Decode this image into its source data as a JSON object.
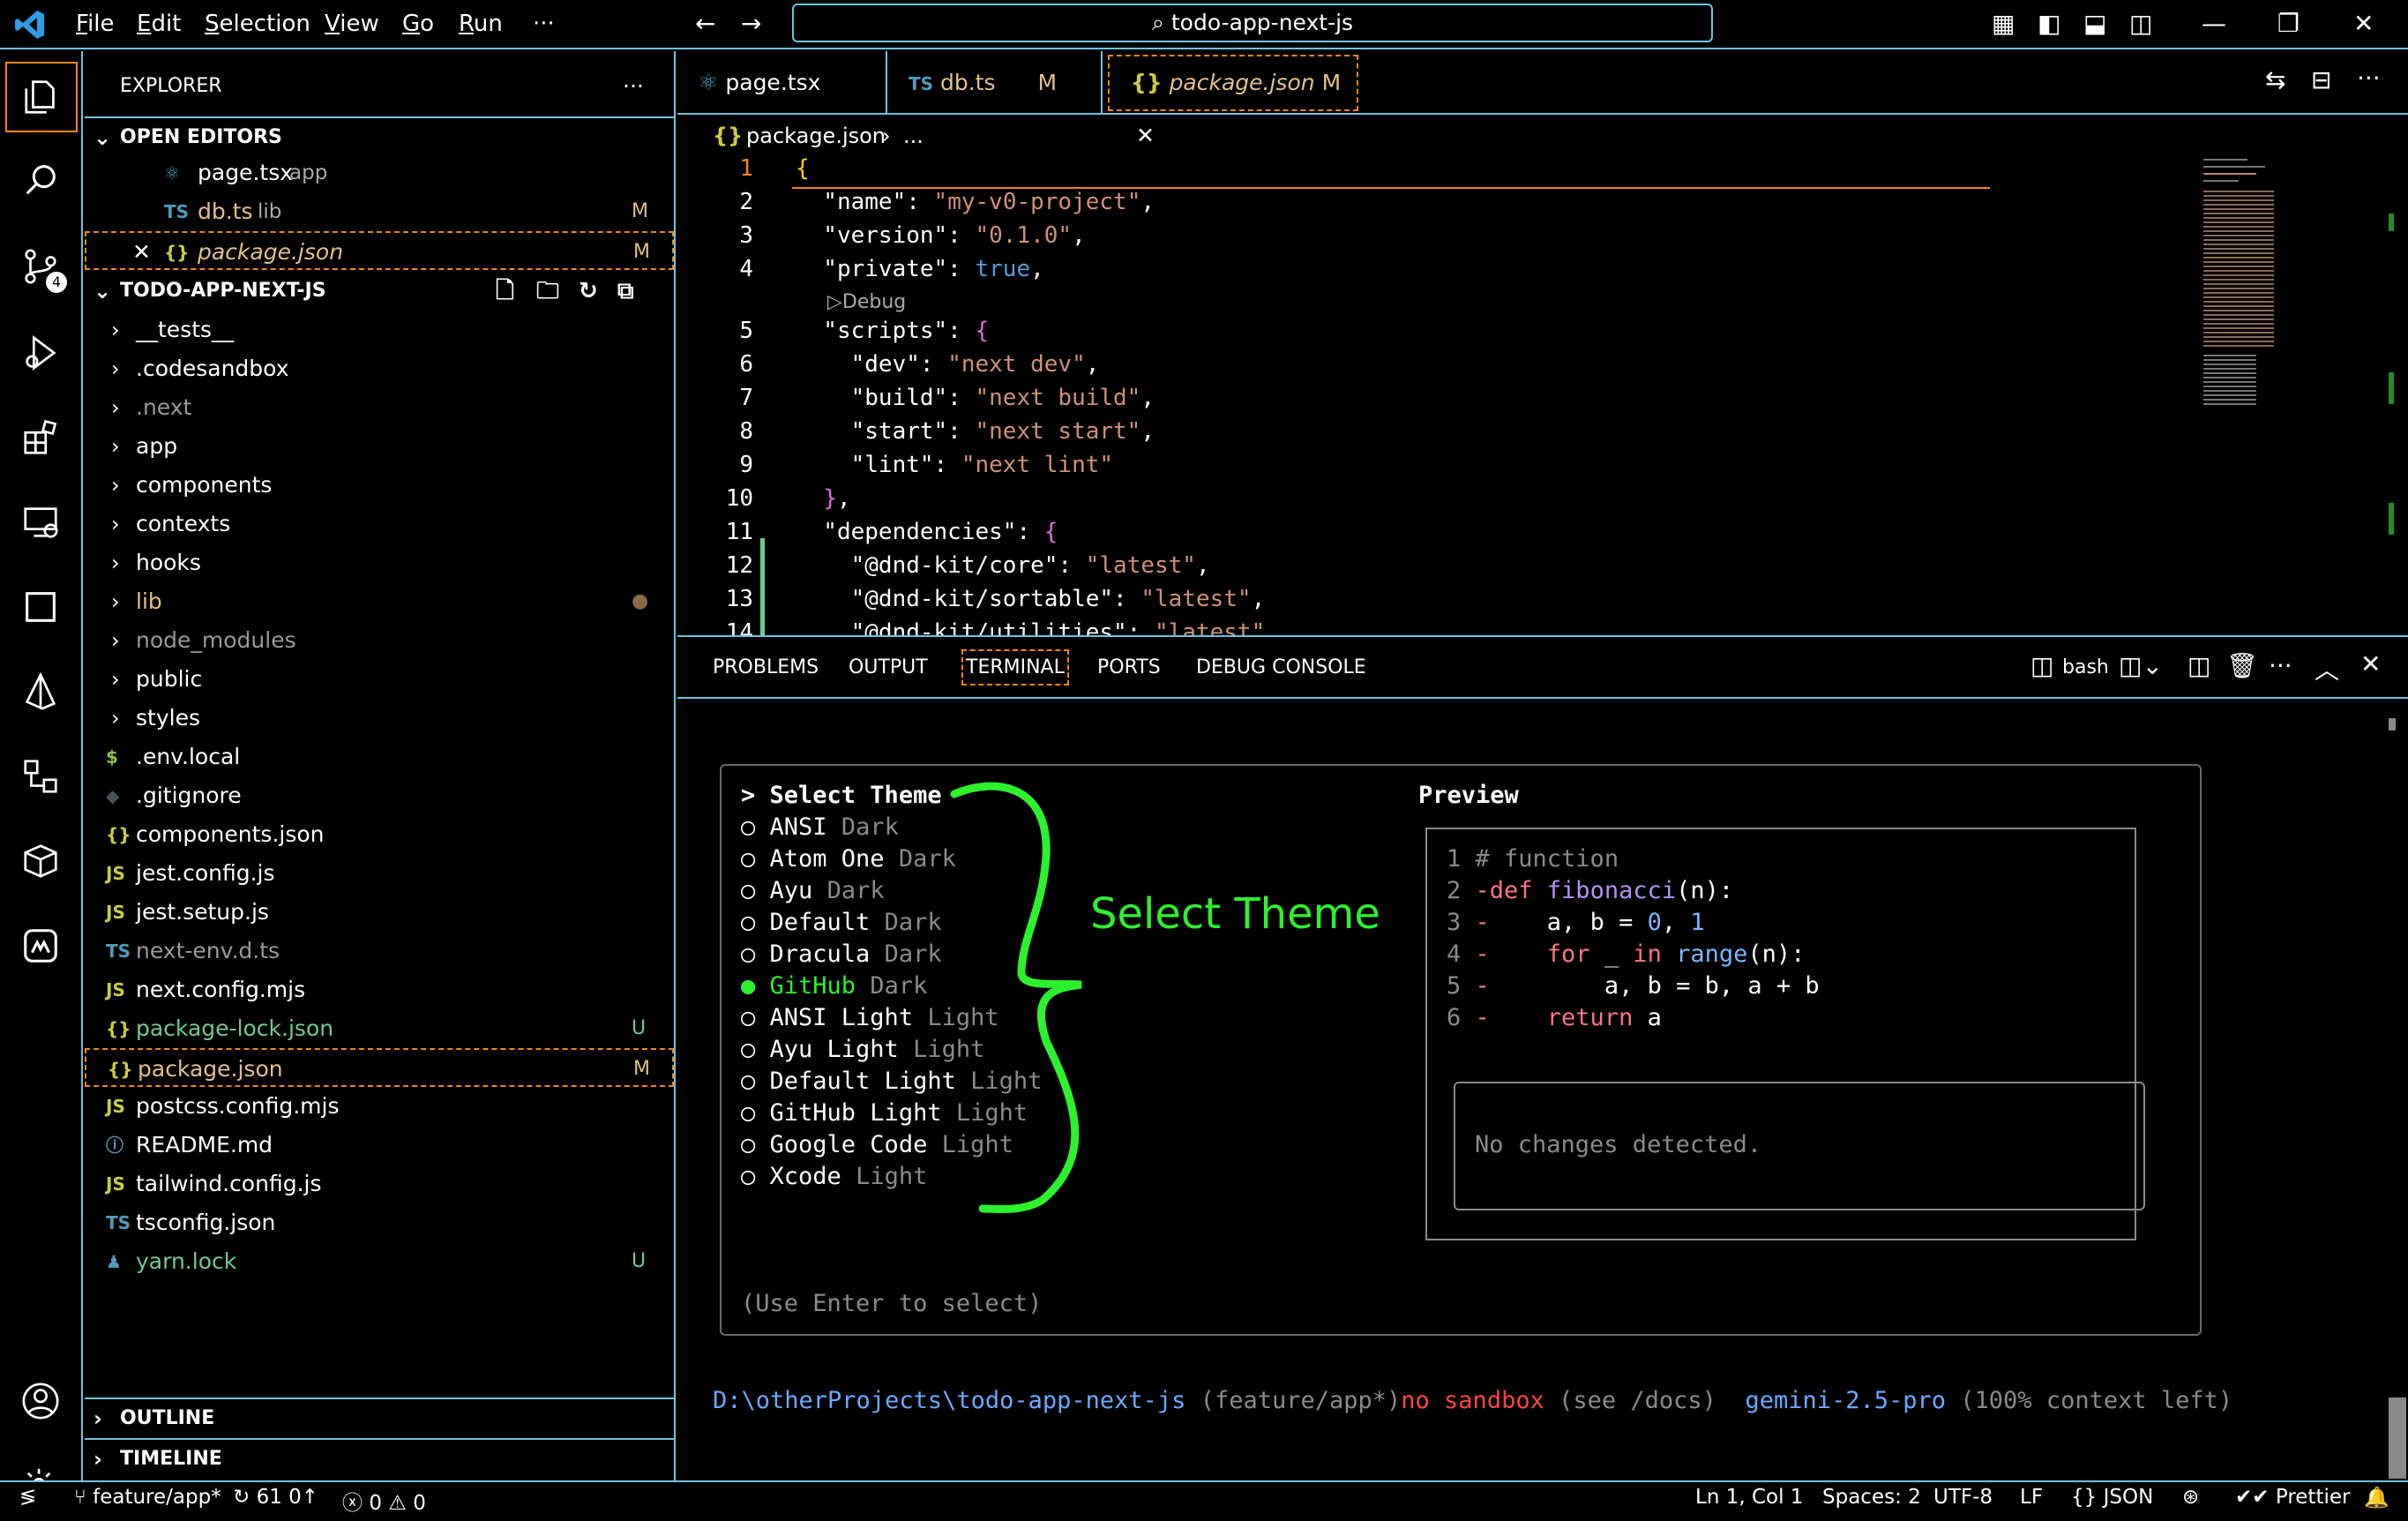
{
  "menu": [
    "File",
    "Edit",
    "Selection",
    "View",
    "Go",
    "Run",
    "···"
  ],
  "command_center": "todo-app-next-js",
  "sidebar": {
    "title": "EXPLORER",
    "open_editors_label": "OPEN EDITORS",
    "open_editors": [
      {
        "name": "page.tsx",
        "detail": "app",
        "icon": "⚛",
        "badge": ""
      },
      {
        "name": "db.ts",
        "detail": "lib",
        "icon": "TS",
        "badge": "M"
      },
      {
        "name": "package.json",
        "detail": "",
        "icon": "{}",
        "badge": "M"
      }
    ],
    "project_label": "TODO-APP-NEXT-JS",
    "items": [
      {
        "name": "__tests__",
        "type": "folder",
        "badge": ""
      },
      {
        "name": ".codesandbox",
        "type": "folder",
        "badge": ""
      },
      {
        "name": ".next",
        "type": "folder",
        "badge": ""
      },
      {
        "name": "app",
        "type": "folder",
        "badge": ""
      },
      {
        "name": "components",
        "type": "folder",
        "badge": ""
      },
      {
        "name": "contexts",
        "type": "folder",
        "badge": ""
      },
      {
        "name": "hooks",
        "type": "folder",
        "badge": ""
      },
      {
        "name": "lib",
        "type": "folder",
        "badge": "●"
      },
      {
        "name": "node_modules",
        "type": "folder",
        "badge": ""
      },
      {
        "name": "public",
        "type": "folder",
        "badge": ""
      },
      {
        "name": "styles",
        "type": "folder",
        "badge": ""
      },
      {
        "name": ".env.local",
        "icon": "$",
        "badge": ""
      },
      {
        "name": ".gitignore",
        "icon": "◆",
        "badge": ""
      },
      {
        "name": "components.json",
        "icon": "{}",
        "badge": ""
      },
      {
        "name": "jest.config.js",
        "icon": "JS",
        "badge": ""
      },
      {
        "name": "jest.setup.js",
        "icon": "JS",
        "badge": ""
      },
      {
        "name": "next-env.d.ts",
        "icon": "TS",
        "badge": ""
      },
      {
        "name": "next.config.mjs",
        "icon": "JS",
        "badge": ""
      },
      {
        "name": "package-lock.json",
        "icon": "{}",
        "badge": "U"
      },
      {
        "name": "package.json",
        "icon": "{}",
        "badge": "M"
      },
      {
        "name": "postcss.config.mjs",
        "icon": "JS",
        "badge": ""
      },
      {
        "name": "README.md",
        "icon": "ⓘ",
        "badge": ""
      },
      {
        "name": "tailwind.config.js",
        "icon": "JS",
        "badge": ""
      },
      {
        "name": "tsconfig.json",
        "icon": "TS",
        "badge": ""
      },
      {
        "name": "yarn.lock",
        "icon": "♟",
        "badge": "U"
      }
    ],
    "outline_label": "OUTLINE",
    "timeline_label": "TIMELINE"
  },
  "tabs": [
    {
      "icon": "⚛",
      "name": "page.tsx",
      "badge": ""
    },
    {
      "icon": "TS",
      "name": "db.ts",
      "badge": "M"
    },
    {
      "icon": "{}",
      "name": "package.json",
      "badge": "M"
    }
  ],
  "breadcrumb": {
    "file": "package.json",
    "rest": "..."
  },
  "editor": {
    "line_numbers": [
      "1",
      "2",
      "3",
      "4",
      "5",
      "6",
      "7",
      "8",
      "9",
      "10",
      "11",
      "12",
      "13",
      "14"
    ],
    "codelens": "Debug"
  },
  "panel": {
    "tabs": [
      "PROBLEMS",
      "OUTPUT",
      "TERMINAL",
      "PORTS",
      "DEBUG CONSOLE"
    ],
    "shell": "bash",
    "theme_title": "Select Theme",
    "themes": [
      {
        "name": "ANSI",
        "kind": "Dark"
      },
      {
        "name": "Atom One",
        "kind": "Dark"
      },
      {
        "name": "Ayu",
        "kind": "Dark"
      },
      {
        "name": "Default",
        "kind": "Dark"
      },
      {
        "name": "Dracula",
        "kind": "Dark"
      },
      {
        "name": "GitHub",
        "kind": "Dark"
      },
      {
        "name": "ANSI Light",
        "kind": "Light"
      },
      {
        "name": "Ayu Light",
        "kind": "Light"
      },
      {
        "name": "Default Light",
        "kind": "Light"
      },
      {
        "name": "GitHub Light",
        "kind": "Light"
      },
      {
        "name": "Google Code",
        "kind": "Light"
      },
      {
        "name": "Xcode",
        "kind": "Light"
      }
    ],
    "selected_theme_index": 5,
    "hint": "(Use Enter to select)",
    "annotation": "Select Theme",
    "preview_title": "Preview",
    "preview_lines": [
      "1 # function",
      "2 -def fibonacci(n):",
      "3 -    a, b = 0, 1",
      "4 -    for _ in range(n):",
      "5 -        a, b = b, a + b",
      "6 -    return a"
    ],
    "no_changes": "No changes detected.",
    "prompt_path": "D:\\otherProjects\\todo-app-next-js",
    "prompt_branch": "(feature/app*)",
    "prompt_sandbox": "no sandbox",
    "prompt_docs": "(see /docs)",
    "prompt_model": "gemini-2.5-pro",
    "prompt_context": "(100% context left)"
  },
  "status": {
    "branch": "feature/app*",
    "sync": "61 0↑",
    "problems": "0",
    "warnings": "0",
    "position": "Ln 1, Col 1",
    "spaces": "Spaces: 2",
    "encoding": "UTF-8",
    "eol": "LF",
    "language": "JSON",
    "formatter": "Prettier"
  },
  "colors": {
    "accent": "#6fc3df",
    "selection": "#f38518",
    "green": "#73c991",
    "annotation": "#2df12d",
    "string": "#ce9178"
  }
}
